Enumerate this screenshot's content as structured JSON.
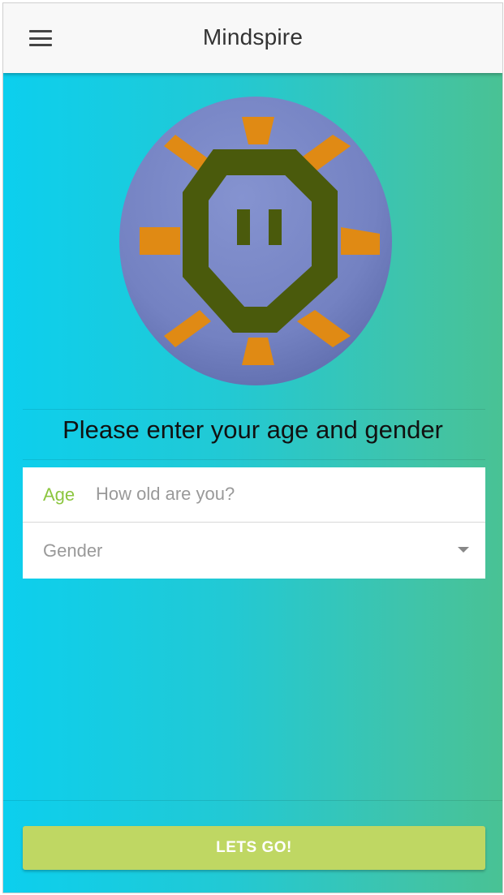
{
  "app": {
    "title": "Mindspire"
  },
  "header": {
    "menu_icon": "hamburger-menu-icon"
  },
  "logo": {
    "icon": "mindspire-logo",
    "colors": {
      "disc": "#7a88c8",
      "rays": "#e08a14",
      "octagon": "#4a5a0c"
    }
  },
  "prompt": "Please enter your age and gender",
  "form": {
    "age_label": "Age",
    "age_placeholder": "How old are you?",
    "age_value": "",
    "gender_label": "Gender",
    "gender_icon": "dropdown-caret-icon"
  },
  "action": {
    "label": "LETS GO!"
  },
  "colors": {
    "gradient_start": "#0ccfee",
    "gradient_end": "#49c294",
    "button": "#bfd763",
    "label_accent": "#8cc63f"
  }
}
